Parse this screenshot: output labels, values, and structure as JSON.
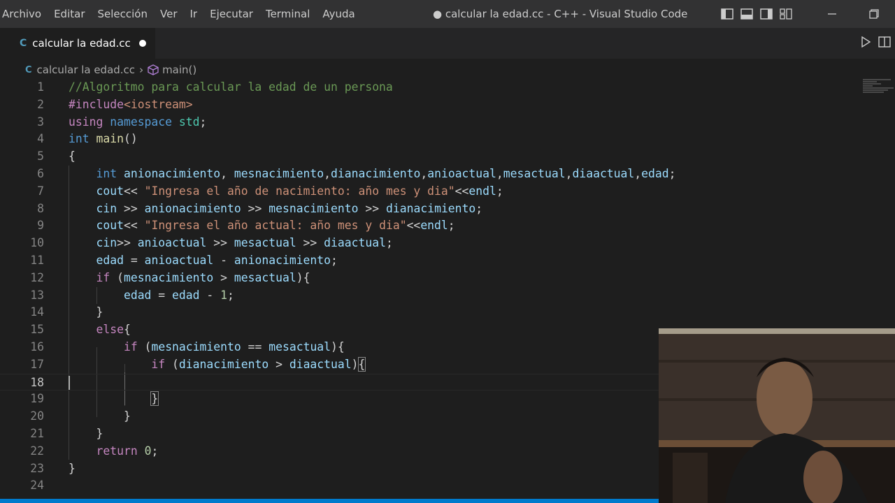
{
  "menu": [
    "Archivo",
    "Editar",
    "Selección",
    "Ver",
    "Ir",
    "Ejecutar",
    "Terminal",
    "Ayuda"
  ],
  "window_title": "● calcular la edad.cc - C++ - Visual Studio Code",
  "tab": {
    "icon": "cpp-file-icon",
    "label": "calcular la edad.cc"
  },
  "breadcrumb": {
    "file": "calcular la edad.cc",
    "symbol": "main()"
  },
  "active_line": 18,
  "colors": {
    "keyword": "#569cd6",
    "control": "#c586c0",
    "string": "#ce9178",
    "variable": "#9cdcfe",
    "comment": "#6a9955",
    "number": "#b5cea8",
    "function": "#dcdcaa",
    "accent": "#007acc"
  },
  "code_lines": [
    [
      [
        "//Algoritmo para calcular la edad de un persona",
        "cm"
      ]
    ],
    [
      [
        "#include",
        "ctl"
      ],
      [
        "<iostream>",
        "str"
      ]
    ],
    [
      [
        "using",
        "ctl"
      ],
      [
        " ",
        "op"
      ],
      [
        "namespace",
        "kw"
      ],
      [
        " ",
        "op"
      ],
      [
        "std",
        "ns"
      ],
      [
        ";",
        "op"
      ]
    ],
    [
      [
        "int",
        "kw"
      ],
      [
        " ",
        "op"
      ],
      [
        "main",
        "fn"
      ],
      [
        "()",
        "op"
      ]
    ],
    [
      [
        "{",
        "op"
      ]
    ],
    [
      [
        "    ",
        "op"
      ],
      [
        "int",
        "kw"
      ],
      [
        " ",
        "op"
      ],
      [
        "anionacimiento",
        "var"
      ],
      [
        ", ",
        "op"
      ],
      [
        "mesnacimiento",
        "var"
      ],
      [
        ",",
        "op"
      ],
      [
        "dianacimiento",
        "var"
      ],
      [
        ",",
        "op"
      ],
      [
        "anioactual",
        "var"
      ],
      [
        ",",
        "op"
      ],
      [
        "mesactual",
        "var"
      ],
      [
        ",",
        "op"
      ],
      [
        "diaactual",
        "var"
      ],
      [
        ",",
        "op"
      ],
      [
        "edad",
        "var"
      ],
      [
        ";",
        "op"
      ]
    ],
    [
      [
        "    ",
        "op"
      ],
      [
        "cout",
        "var"
      ],
      [
        "<< ",
        "op"
      ],
      [
        "\"Ingresa el año de nacimiento: año mes y dia\"",
        "str"
      ],
      [
        "<<",
        "op"
      ],
      [
        "endl",
        "var"
      ],
      [
        ";",
        "op"
      ]
    ],
    [
      [
        "    ",
        "op"
      ],
      [
        "cin",
        "var"
      ],
      [
        " >> ",
        "op"
      ],
      [
        "anionacimiento",
        "var"
      ],
      [
        " >> ",
        "op"
      ],
      [
        "mesnacimiento",
        "var"
      ],
      [
        " >> ",
        "op"
      ],
      [
        "dianacimiento",
        "var"
      ],
      [
        ";",
        "op"
      ]
    ],
    [
      [
        "    ",
        "op"
      ],
      [
        "cout",
        "var"
      ],
      [
        "<< ",
        "op"
      ],
      [
        "\"Ingresa el año actual: año mes y dia\"",
        "str"
      ],
      [
        "<<",
        "op"
      ],
      [
        "endl",
        "var"
      ],
      [
        ";",
        "op"
      ]
    ],
    [
      [
        "    ",
        "op"
      ],
      [
        "cin",
        "var"
      ],
      [
        ">> ",
        "op"
      ],
      [
        "anioactual",
        "var"
      ],
      [
        " >> ",
        "op"
      ],
      [
        "mesactual",
        "var"
      ],
      [
        " >> ",
        "op"
      ],
      [
        "diaactual",
        "var"
      ],
      [
        ";",
        "op"
      ]
    ],
    [
      [
        "    ",
        "op"
      ],
      [
        "edad",
        "var"
      ],
      [
        " = ",
        "op"
      ],
      [
        "anioactual",
        "var"
      ],
      [
        " - ",
        "op"
      ],
      [
        "anionacimiento",
        "var"
      ],
      [
        ";",
        "op"
      ]
    ],
    [
      [
        "    ",
        "op"
      ],
      [
        "if",
        "ctl"
      ],
      [
        " (",
        "op"
      ],
      [
        "mesnacimiento",
        "var"
      ],
      [
        " > ",
        "op"
      ],
      [
        "mesactual",
        "var"
      ],
      [
        "){",
        "op"
      ]
    ],
    [
      [
        "        ",
        "op"
      ],
      [
        "edad",
        "var"
      ],
      [
        " = ",
        "op"
      ],
      [
        "edad",
        "var"
      ],
      [
        " - ",
        "op"
      ],
      [
        "1",
        "num"
      ],
      [
        ";",
        "op"
      ]
    ],
    [
      [
        "    ",
        "op"
      ],
      [
        "}",
        "op"
      ]
    ],
    [
      [
        "    ",
        "op"
      ],
      [
        "else",
        "ctl"
      ],
      [
        "{",
        "op"
      ]
    ],
    [
      [
        "        ",
        "op"
      ],
      [
        "if",
        "ctl"
      ],
      [
        " (",
        "op"
      ],
      [
        "mesnacimiento",
        "var"
      ],
      [
        " == ",
        "op"
      ],
      [
        "mesactual",
        "var"
      ],
      [
        "){",
        "op"
      ]
    ],
    [
      [
        "            ",
        "op"
      ],
      [
        "if",
        "ctl"
      ],
      [
        " (",
        "op"
      ],
      [
        "dianacimiento",
        "var"
      ],
      [
        " > ",
        "op"
      ],
      [
        "diaactual",
        "var"
      ],
      [
        ")",
        "op"
      ],
      [
        "{",
        "bm"
      ]
    ],
    [],
    [
      [
        "            ",
        "op"
      ],
      [
        "}",
        "bm"
      ]
    ],
    [
      [
        "        ",
        "op"
      ],
      [
        "}",
        "op"
      ]
    ],
    [
      [
        "    ",
        "op"
      ],
      [
        "}",
        "op"
      ]
    ],
    [
      [
        "    ",
        "op"
      ],
      [
        "return",
        "ctl"
      ],
      [
        " ",
        "op"
      ],
      [
        "0",
        "num"
      ],
      [
        ";",
        "op"
      ]
    ],
    [
      [
        "}",
        "op"
      ]
    ],
    []
  ]
}
